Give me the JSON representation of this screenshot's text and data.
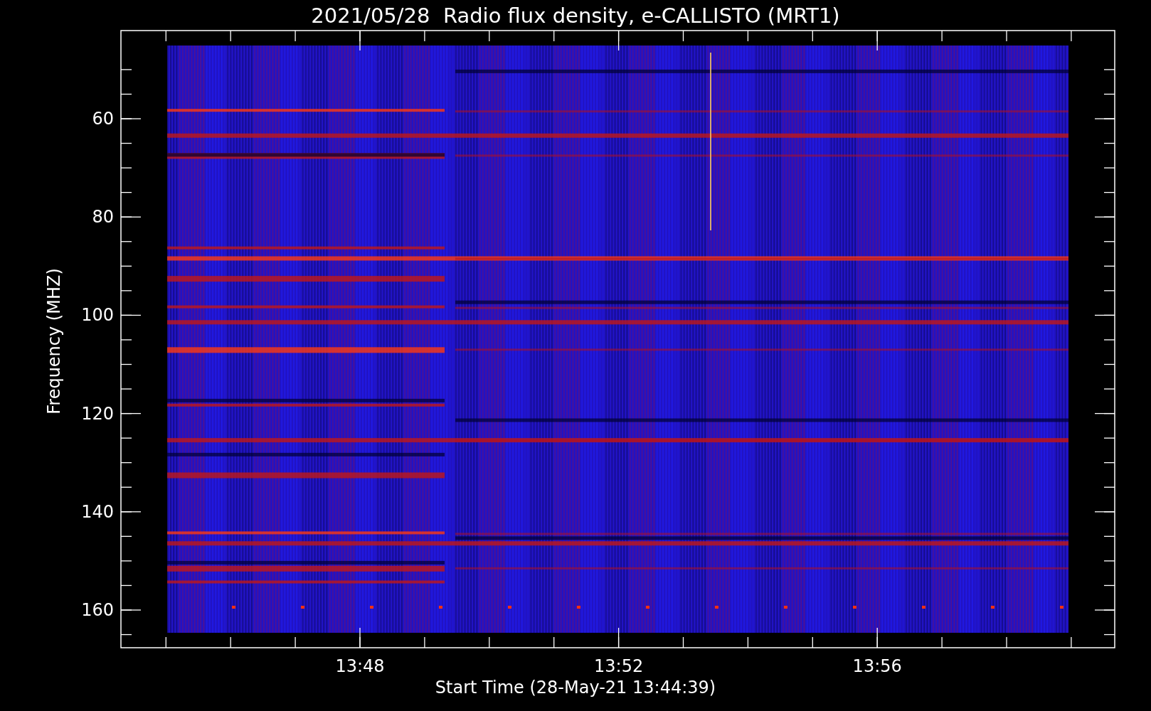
{
  "title": "2021/05/28  Radio flux density, e-CALLISTO (MRT1)",
  "yaxis": {
    "label": "Frequency (MHZ)",
    "ticks": [
      "60",
      "80",
      "100",
      "120",
      "140",
      "160"
    ]
  },
  "xaxis": {
    "label": "Start Time (28-May-21 13:44:39)",
    "ticks": [
      "13:48",
      "13:52",
      "13:56"
    ]
  }
}
